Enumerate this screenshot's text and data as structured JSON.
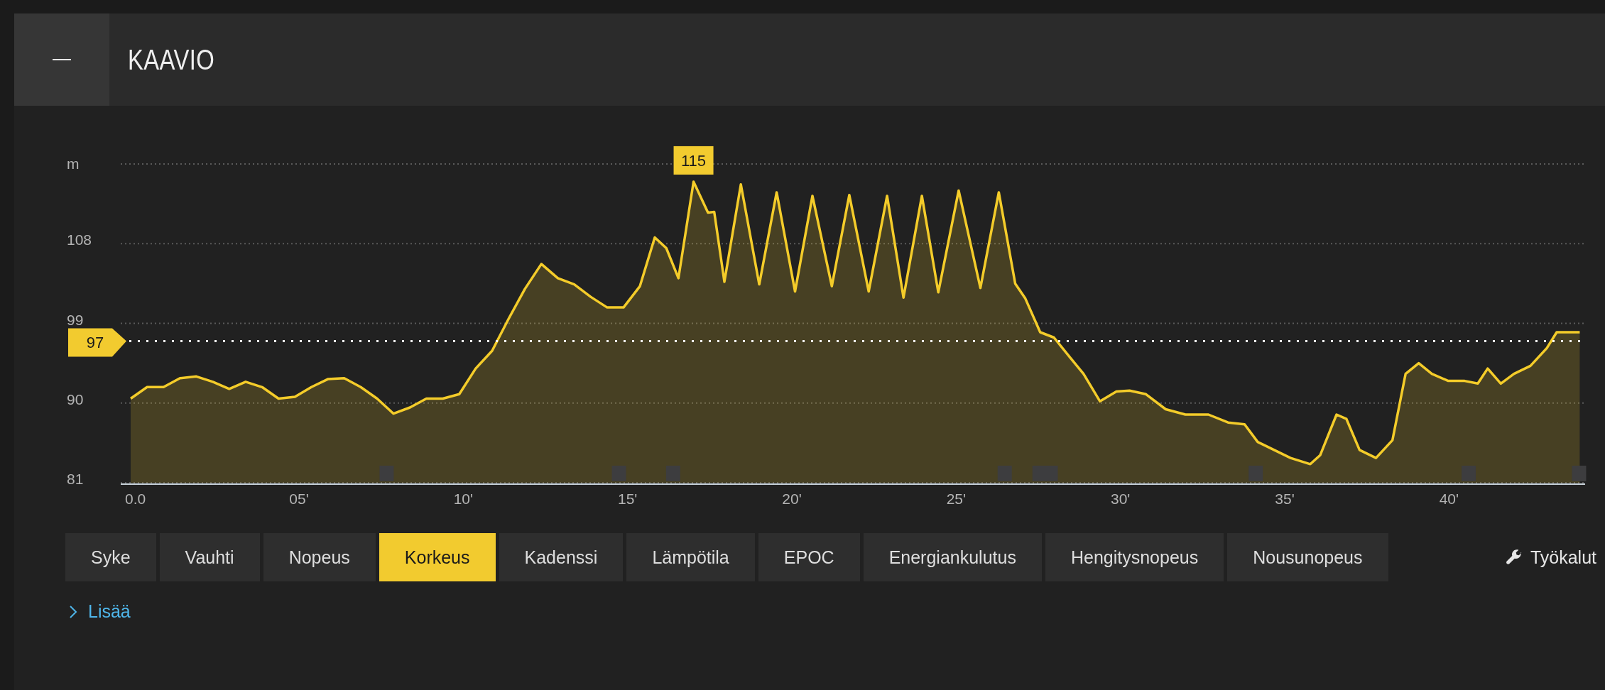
{
  "header": {
    "title": "KAAVIO"
  },
  "chart": {
    "chart_data": {
      "type": "area",
      "ylabel": "m",
      "xlim": [
        0,
        44.2
      ],
      "ylim": [
        81,
        117
      ],
      "x": [
        0,
        0.5,
        1,
        1.5,
        2,
        2.5,
        3,
        3.5,
        4,
        4.5,
        5,
        5.5,
        6,
        6.5,
        7,
        7.5,
        8,
        8.5,
        9,
        9.5,
        10,
        10.5,
        11,
        11.5,
        12,
        12.5,
        13,
        13.5,
        14,
        14.5,
        15,
        15.5,
        15.95,
        16.3,
        16.67,
        17.13,
        17.57,
        17.76,
        18.07,
        18.57,
        19.13,
        19.66,
        20.22,
        20.75,
        21.34,
        21.87,
        22.46,
        23.02,
        23.52,
        24.08,
        24.58,
        25.2,
        25.86,
        26.42,
        26.92,
        27.23,
        27.68,
        28.1,
        28.6,
        29,
        29.5,
        30,
        30.4,
        30.9,
        31.5,
        32.1,
        32.8,
        33.4,
        33.9,
        34.3,
        34.8,
        35.3,
        35.9,
        36.2,
        36.7,
        37,
        37.4,
        37.9,
        38.4,
        38.8,
        39.2,
        39.6,
        40.1,
        40.6,
        41,
        41.3,
        41.7,
        42.1,
        42.6,
        43.1,
        43.4,
        43.8,
        44.1
      ],
      "series": [
        {
          "color": "#f4cc2a",
          "values": [
            90.5,
            91.8,
            91.8,
            92.8,
            93.0,
            92.4,
            91.6,
            92.4,
            91.8,
            90.5,
            90.7,
            91.8,
            92.7,
            92.8,
            91.8,
            90.5,
            88.8,
            89.5,
            90.5,
            90.5,
            91.0,
            93.9,
            95.9,
            99.5,
            102.9,
            105.7,
            104.1,
            103.4,
            102.0,
            100.8,
            100.8,
            103.2,
            108.7,
            107.5,
            104.1,
            115,
            111.5,
            111.6,
            103.7,
            114.7,
            103.4,
            113.8,
            102.6,
            113.4,
            103.2,
            113.5,
            102.6,
            113.4,
            101.9,
            113.4,
            102.5,
            114.0,
            103.0,
            113.8,
            103.5,
            101.8,
            98.0,
            97.4,
            95.1,
            93.3,
            90.2,
            91.3,
            91.4,
            91.0,
            89.3,
            88.7,
            88.7,
            87.8,
            87.6,
            85.6,
            84.7,
            83.8,
            83.1,
            84.1,
            88.7,
            88.2,
            84.7,
            83.8,
            85.8,
            93.3,
            94.5,
            93.3,
            92.5,
            92.5,
            92.2,
            93.9,
            92.2,
            93.3,
            94.2,
            96.2,
            98.0,
            98.0,
            98.0
          ]
        }
      ],
      "xticks": [
        {
          "value": 0,
          "label": "0.0"
        },
        {
          "value": 5,
          "label": "05'"
        },
        {
          "value": 10,
          "label": "10'"
        },
        {
          "value": 15,
          "label": "15'"
        },
        {
          "value": 20,
          "label": "20'"
        },
        {
          "value": 25,
          "label": "25'"
        },
        {
          "value": 30,
          "label": "30'"
        },
        {
          "value": 35,
          "label": "35'"
        },
        {
          "value": 40,
          "label": "40'"
        }
      ],
      "yticks": [
        81,
        90,
        99,
        108
      ],
      "grid": true,
      "ref_lines": [
        {
          "axis": "y",
          "value": 97,
          "label": "97"
        }
      ],
      "annotations": [
        {
          "x": 17.13,
          "y": 115,
          "text": "115"
        }
      ]
    }
  },
  "tabs": [
    {
      "label": "Syke",
      "selected": false
    },
    {
      "label": "Vauhti",
      "selected": false
    },
    {
      "label": "Nopeus",
      "selected": false
    },
    {
      "label": "Korkeus",
      "selected": true
    },
    {
      "label": "Kadenssi",
      "selected": false
    },
    {
      "label": "Lämpötila",
      "selected": false
    },
    {
      "label": "EPOC",
      "selected": false
    },
    {
      "label": "Energiankulutus",
      "selected": false
    },
    {
      "label": "Hengitysnopeus",
      "selected": false
    },
    {
      "label": "Nousunopeus",
      "selected": false
    }
  ],
  "tools": {
    "label": "Työkalut"
  },
  "more_link": {
    "label": "Lisää"
  }
}
